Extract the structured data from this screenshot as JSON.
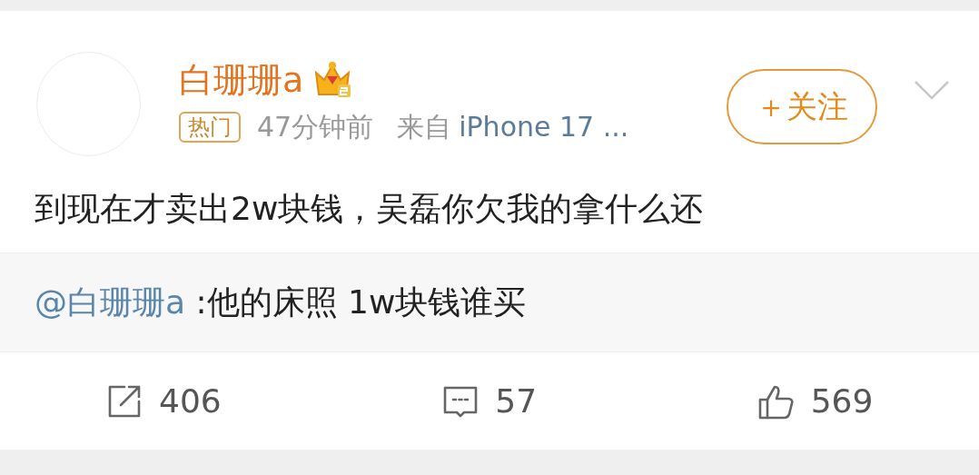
{
  "author": {
    "name": "白珊珊a",
    "badge": "热门",
    "time": "47分钟前",
    "source_prefix": "来自",
    "source": "iPhone 17 ..."
  },
  "follow_button": {
    "label": "＋关注"
  },
  "post": {
    "text": "到现在才卖出2w块钱，吴磊你欠我的拿什么还"
  },
  "repost": {
    "mention": "@白珊珊a",
    "text": ":他的床照 1w块钱谁买"
  },
  "actions": [
    {
      "kind": "share",
      "count": "406"
    },
    {
      "kind": "comment",
      "count": "57"
    },
    {
      "kind": "like",
      "count": "569"
    }
  ]
}
